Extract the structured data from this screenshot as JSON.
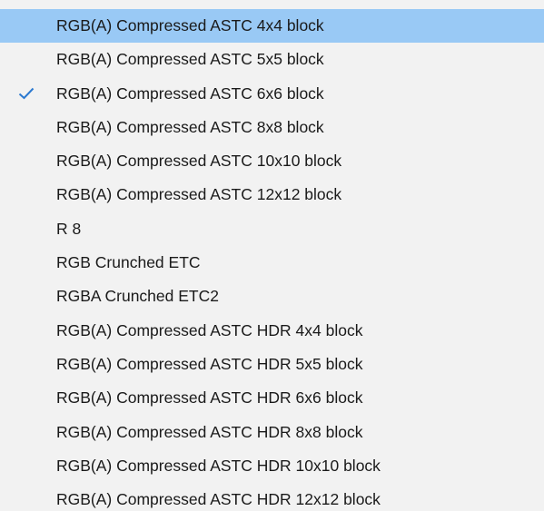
{
  "menu": {
    "items": [
      {
        "label": "RGB(A) Compressed ASTC 4x4 block",
        "highlighted": true,
        "checked": false
      },
      {
        "label": "RGB(A) Compressed ASTC 5x5 block",
        "highlighted": false,
        "checked": false
      },
      {
        "label": "RGB(A) Compressed ASTC 6x6 block",
        "highlighted": false,
        "checked": true
      },
      {
        "label": "RGB(A) Compressed ASTC 8x8 block",
        "highlighted": false,
        "checked": false
      },
      {
        "label": "RGB(A) Compressed ASTC 10x10 block",
        "highlighted": false,
        "checked": false
      },
      {
        "label": "RGB(A) Compressed ASTC 12x12 block",
        "highlighted": false,
        "checked": false
      },
      {
        "label": "R 8",
        "highlighted": false,
        "checked": false
      },
      {
        "label": "RGB Crunched ETC",
        "highlighted": false,
        "checked": false
      },
      {
        "label": "RGBA Crunched ETC2",
        "highlighted": false,
        "checked": false
      },
      {
        "label": "RGB(A) Compressed ASTC HDR 4x4 block",
        "highlighted": false,
        "checked": false
      },
      {
        "label": "RGB(A) Compressed ASTC HDR 5x5 block",
        "highlighted": false,
        "checked": false
      },
      {
        "label": "RGB(A) Compressed ASTC HDR 6x6 block",
        "highlighted": false,
        "checked": false
      },
      {
        "label": "RGB(A) Compressed ASTC HDR 8x8 block",
        "highlighted": false,
        "checked": false
      },
      {
        "label": "RGB(A) Compressed ASTC HDR 10x10 block",
        "highlighted": false,
        "checked": false
      },
      {
        "label": "RGB(A) Compressed ASTC HDR 12x12 block",
        "highlighted": false,
        "checked": false
      }
    ],
    "check_icon": "checkmark-icon"
  },
  "colors": {
    "background": "#f2f2f2",
    "highlight": "#99c9f5",
    "text": "#1a1a1a",
    "check": "#2b79d0"
  }
}
